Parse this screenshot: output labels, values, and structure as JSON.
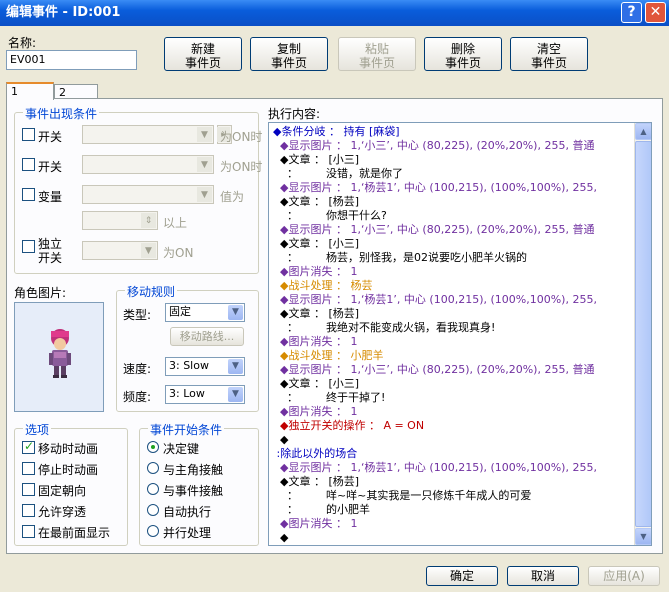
{
  "window": {
    "title": "编辑事件 - ID:001",
    "help_icon": "?",
    "close_icon": "✕"
  },
  "name": {
    "label": "名称:",
    "value": "EV001"
  },
  "toolbar": [
    {
      "id": "new",
      "line1": "新建",
      "line2": "事件页",
      "enabled": true
    },
    {
      "id": "copy",
      "line1": "复制",
      "line2": "事件页",
      "enabled": true
    },
    {
      "id": "paste",
      "line1": "粘贴",
      "line2": "事件页",
      "enabled": false
    },
    {
      "id": "delete",
      "line1": "删除",
      "line2": "事件页",
      "enabled": true
    },
    {
      "id": "clear",
      "line1": "清空",
      "line2": "事件页",
      "enabled": true
    }
  ],
  "tabs": [
    "1",
    "2"
  ],
  "conditions": {
    "title": "事件出现条件",
    "switch1": "开关",
    "switch1_suffix": "为ON时",
    "switch2": "开关",
    "switch2_suffix": "为ON时",
    "variable": "变量",
    "variable_suffix": "值为",
    "above": "以上",
    "self_switch_line1": "独立",
    "self_switch_line2": "开关",
    "self_switch_suffix": "为ON"
  },
  "graphic": {
    "label": "角色图片:"
  },
  "movement": {
    "title": "移动规则",
    "type_label": "类型:",
    "type_value": "固定",
    "route_button": "移动路线...",
    "speed_label": "速度:",
    "speed_value": "3: Slow",
    "freq_label": "频度:",
    "freq_value": "3: Low"
  },
  "options": {
    "title": "选项",
    "items": [
      {
        "label": "移动时动画",
        "checked": true
      },
      {
        "label": "停止时动画",
        "checked": false
      },
      {
        "label": "固定朝向",
        "checked": false
      },
      {
        "label": "允许穿透",
        "checked": false
      },
      {
        "label": "在最前面显示",
        "checked": false
      }
    ]
  },
  "trigger": {
    "title": "事件开始条件",
    "items": [
      {
        "label": "决定键",
        "selected": true
      },
      {
        "label": "与主角接触",
        "selected": false
      },
      {
        "label": "与事件接触",
        "selected": false
      },
      {
        "label": "自动执行",
        "selected": false
      },
      {
        "label": "并行处理",
        "selected": false
      }
    ]
  },
  "contents": {
    "label": "执行内容:",
    "lines": [
      {
        "text": "◆条件分岐 ： 持有 [麻袋]",
        "color": "#0000c0"
      },
      {
        "text": "  ◆显示图片 ： 1,‘小三’, 中心 (80,225), (20%,20%), 255, 普通",
        "color": "#7030a0"
      },
      {
        "text": "  ◆文章 ： [小三]",
        "color": "#000000"
      },
      {
        "text": "    ：        没错，就是你了",
        "color": "#000000"
      },
      {
        "text": "  ◆显示图片 ： 1,‘杨芸1’, 中心 (100,215), (100%,100%), 255,",
        "color": "#7030a0"
      },
      {
        "text": "  ◆文章 ： [杨芸]",
        "color": "#000000"
      },
      {
        "text": "    ：        你想干什么?",
        "color": "#000000"
      },
      {
        "text": "  ◆显示图片 ： 1,‘小三’, 中心 (80,225), (20%,20%), 255, 普通",
        "color": "#7030a0"
      },
      {
        "text": "  ◆文章 ： [小三]",
        "color": "#000000"
      },
      {
        "text": "    ：        杨芸，别怪我，是02说要吃小肥羊火锅的",
        "color": "#000000"
      },
      {
        "text": "  ◆图片消失 ： 1",
        "color": "#7030a0"
      },
      {
        "text": "  ◆战斗处理 ： 杨芸",
        "color": "#d68b00"
      },
      {
        "text": "  ◆显示图片 ： 1,‘杨芸1’, 中心 (100,215), (100%,100%), 255,",
        "color": "#7030a0"
      },
      {
        "text": "  ◆文章 ： [杨芸]",
        "color": "#000000"
      },
      {
        "text": "    ：        我绝对不能变成火锅，看我现真身!",
        "color": "#000000"
      },
      {
        "text": "  ◆图片消失 ： 1",
        "color": "#7030a0"
      },
      {
        "text": "  ◆战斗处理 ： 小肥羊",
        "color": "#d68b00"
      },
      {
        "text": "  ◆显示图片 ： 1,‘小三’, 中心 (80,225), (20%,20%), 255, 普通",
        "color": "#7030a0"
      },
      {
        "text": "  ◆文章 ： [小三]",
        "color": "#000000"
      },
      {
        "text": "    ：        终于干掉了!",
        "color": "#000000"
      },
      {
        "text": "  ◆图片消失 ： 1",
        "color": "#7030a0"
      },
      {
        "text": "  ◆独立开关的操作 ： A = ON",
        "color": "#c00000"
      },
      {
        "text": "  ◆",
        "color": "#000000"
      },
      {
        "text": " :除此以外的场合",
        "color": "#0000c0"
      },
      {
        "text": "  ◆显示图片 ： 1,‘杨芸1’, 中心 (100,215), (100%,100%), 255,",
        "color": "#7030a0"
      },
      {
        "text": "  ◆文章 ： [杨芸]",
        "color": "#000000"
      },
      {
        "text": "    ：        咩~咩~其实我是一只修炼千年成人的可爱",
        "color": "#000000"
      },
      {
        "text": "    ：        的小肥羊",
        "color": "#000000"
      },
      {
        "text": "  ◆图片消失 ： 1",
        "color": "#7030a0"
      },
      {
        "text": "  ◆",
        "color": "#000000"
      }
    ]
  },
  "footer": {
    "ok": "确定",
    "cancel": "取消",
    "apply": "应用(A)"
  }
}
